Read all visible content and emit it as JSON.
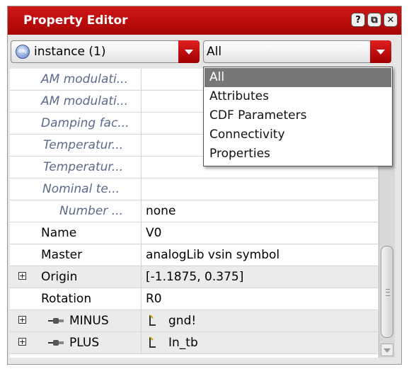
{
  "panel": {
    "title": "Property Editor",
    "buttons": [
      "?",
      "⧉",
      "✕"
    ]
  },
  "selector": {
    "label": "instance (1)",
    "icon": "obj-icon"
  },
  "filter": {
    "value": "All"
  },
  "dropdown": {
    "items": [
      "All",
      "Attributes",
      "CDF Parameters",
      "Connectivity",
      "Properties"
    ],
    "selected": "All"
  },
  "rows": [
    {
      "name": "AM modulati...",
      "value": ""
    },
    {
      "name": "AM modulati...",
      "value": ""
    },
    {
      "name": "Damping fac...",
      "value": ""
    },
    {
      "name": "Temperatur...",
      "value": ""
    },
    {
      "name": "Temperatur...",
      "value": ""
    },
    {
      "name": "Nominal te...",
      "value": ""
    },
    {
      "name": "Number ...",
      "value": "none"
    },
    {
      "name": "Name",
      "value": "V0"
    },
    {
      "name": "Master",
      "value": "analogLib vsin symbol"
    },
    {
      "name": "Origin",
      "value": "[-1.1875, 0.375]"
    },
    {
      "name": "Rotation",
      "value": "R0"
    },
    {
      "name": "MINUS",
      "value": "gnd!"
    },
    {
      "name": "PLUS",
      "value": "In_tb"
    }
  ],
  "colors": {
    "title_bar": "#b80a0a",
    "accent": "#d01010",
    "italic_text": "#5a6a8a"
  }
}
